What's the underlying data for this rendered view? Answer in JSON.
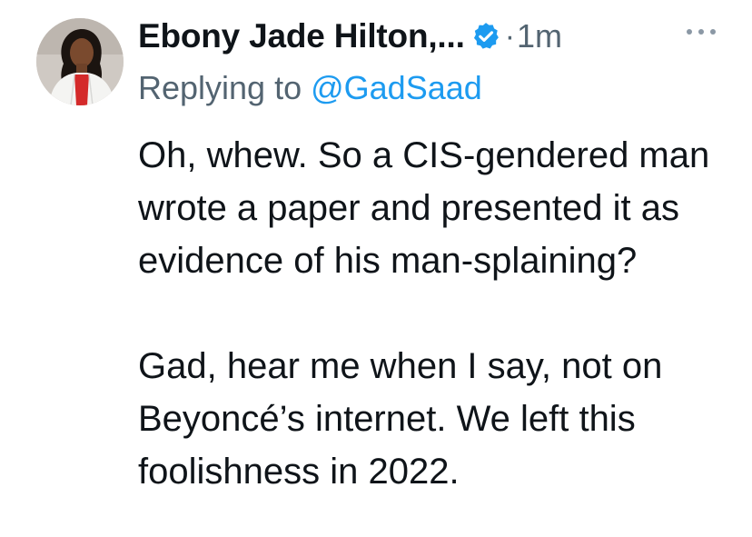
{
  "tweet": {
    "display_name": "Ebony Jade Hilton,...",
    "separator": "·",
    "time": "1m",
    "verified": true,
    "replying_prefix": "Replying to ",
    "replying_handle": "@GadSaad",
    "paragraphs": [
      "Oh, whew. So a CIS-gendered man wrote a paper and presented it as evidence of his man-splaining?",
      "Gad, hear me when I say, not on Beyoncé’s internet. We left this foolishness in 2022."
    ]
  },
  "icons": {
    "verified": "verified-badge-icon",
    "more": "more-options-icon"
  },
  "colors": {
    "primary_text": "#0f1419",
    "secondary_text": "#536471",
    "accent": "#1d9bf0"
  }
}
